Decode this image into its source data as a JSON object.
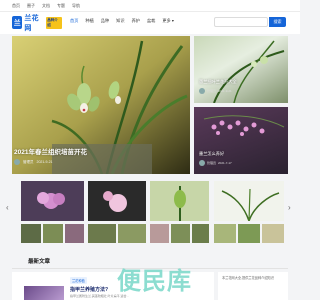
{
  "topbar": {
    "items": [
      "首页",
      "圈子",
      "文档",
      "专题",
      "导航"
    ]
  },
  "logo": {
    "mark": "兰",
    "text": "兰花网",
    "badge": "品种介绍"
  },
  "nav": {
    "items": [
      "首页",
      "种植",
      "品种",
      "知识",
      "养护",
      "盆栽",
      "更多"
    ],
    "active_index": 0
  },
  "search": {
    "placeholder": "",
    "button_label": "搜索"
  },
  "hero": {
    "title": "2021年春兰组织培苗开花",
    "author": "管理员",
    "date": "2021-9-21"
  },
  "side_cards": [
    {
      "title": "蕙兰细叶兰花开大全",
      "author": "管理员",
      "date": "2021-9-21"
    },
    {
      "title": "墨兰怎么养好",
      "author": "管理员",
      "date": "2021-7-17"
    }
  ],
  "latest": {
    "heading": "最新文章",
    "badge": "兰花种植",
    "post_title": "指甲兰养殖方法?",
    "post_desc": "指甲兰属附生兰,其茎较粗壮,叶片扁平,适合..."
  },
  "widget": {
    "text": "本兰花网大全,提供兰花品种介绍知识"
  },
  "watermark": "便民库",
  "colors": {
    "brand": "#1565d8",
    "badge_yellow": "#f6c31a"
  },
  "icons": {
    "prev": "chevron-left-icon",
    "next": "chevron-right-icon"
  }
}
